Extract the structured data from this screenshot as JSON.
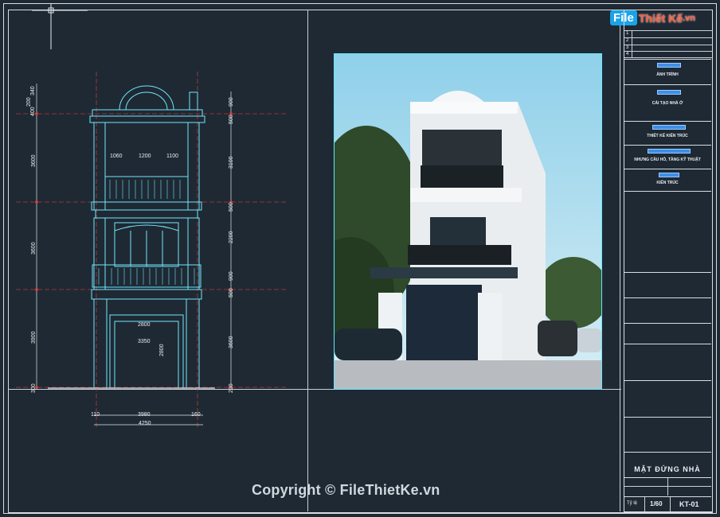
{
  "logo": {
    "part1": "File",
    "part2": "Thiết Kế",
    "part3": ".vn"
  },
  "watermark": "Copyright © FileThietKe.vn",
  "title_block": {
    "row_labels": [
      "1",
      "2",
      "3",
      "4"
    ],
    "items": [
      "ẢNH TRÌNH",
      "CẢI TẠO NHÀ Ở",
      "THIẾT KẾ KIẾN TRÚC",
      "NHƯNG CẦU HỖ, TẦNG KỸ THUẬT",
      "KIẾN TRÚC"
    ],
    "drawing_title": "MẶT ĐỨNG NHÀ",
    "scale_label": "Tỷ lệ",
    "scale": "1/60",
    "sheet": "KT-01"
  },
  "elevation_dims": {
    "left": [
      "340",
      "200",
      "400",
      "3600",
      "3600",
      "3900",
      "300"
    ],
    "right": [
      "900",
      "500",
      "3100",
      "500",
      "2200",
      "900",
      "500",
      "3600",
      "200"
    ],
    "inner": [
      "1060",
      "1200",
      "1100",
      "2800",
      "3350",
      "2800"
    ],
    "bottom": [
      "110",
      "3980",
      "160",
      "4250"
    ]
  },
  "colors": {
    "background": "#1f2933",
    "cad_cyan": "#6fe6ff",
    "cad_red": "#e04040",
    "frame": "#d7dde2"
  }
}
